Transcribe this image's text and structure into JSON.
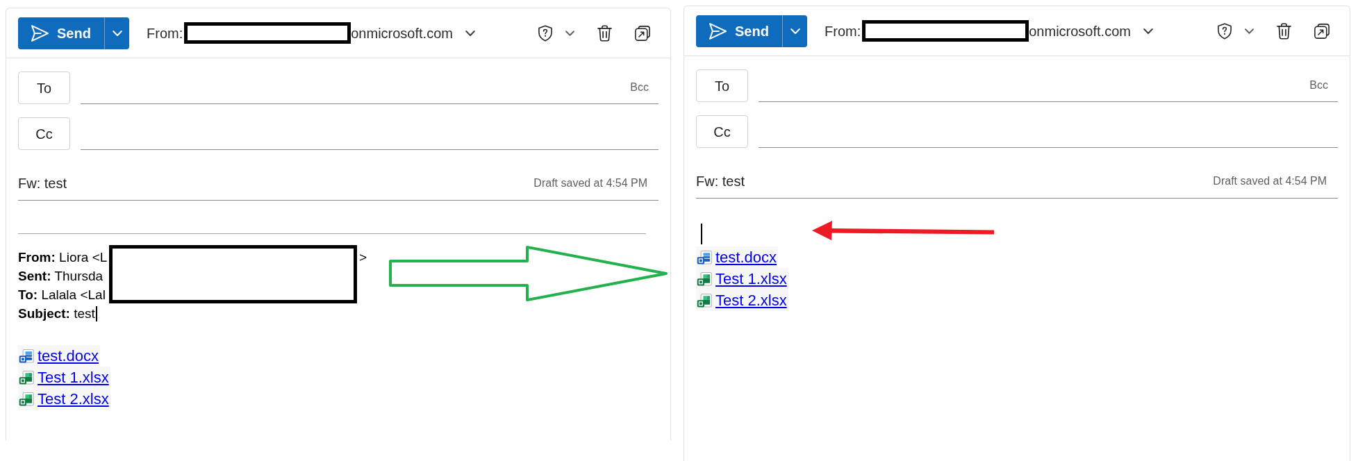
{
  "panels": [
    {
      "send_button": {
        "label": "Send"
      },
      "from": {
        "label": "From:",
        "redacted": true,
        "address": "onmicrosoft.com"
      },
      "to": {
        "label": "To",
        "bcc": "Bcc"
      },
      "cc": {
        "label": "Cc"
      },
      "subject": {
        "value": "Fw: test",
        "status": "Draft saved at 4:54 PM"
      },
      "body": [
        {
          "kind": "rule"
        },
        {
          "kind": "forwarded_header",
          "redacted": true,
          "lines": [
            {
              "text": "**From:** Liora <L",
              "tail": ">",
              "caret": false
            },
            {
              "text": "**Sent:** Thursda",
              "caret": false
            },
            {
              "text": "**To:** Lalala <Lal",
              "caret": false
            },
            {
              "text": "**Subject:** test",
              "caret": true
            }
          ]
        },
        {
          "kind": "attachments",
          "items": [
            {
              "kind": "word",
              "name": "test.docx"
            },
            {
              "kind": "excel",
              "name": "Test 1.xlsx"
            },
            {
              "kind": "excel",
              "name": "Test 2.xlsx"
            }
          ]
        }
      ]
    },
    {
      "send_button": {
        "label": "Send"
      },
      "from": {
        "label": "From:",
        "redacted": true,
        "address": "onmicrosoft.com"
      },
      "to": {
        "label": "To",
        "bcc": "Bcc"
      },
      "cc": {
        "label": "Cc"
      },
      "subject": {
        "value": "Fw: test",
        "status": "Draft saved at 4:54 PM"
      },
      "body": [
        {
          "kind": "caret_line"
        },
        {
          "kind": "attachments",
          "items": [
            {
              "kind": "word",
              "name": "test.docx"
            },
            {
              "kind": "excel",
              "name": "Test 1.xlsx"
            },
            {
              "kind": "excel",
              "name": "Test 2.xlsx"
            }
          ]
        }
      ]
    }
  ],
  "annotations": [
    {
      "kind": "outline_arrow",
      "color": "#22b14c"
    },
    {
      "kind": "filled_arrow",
      "color": "#ed1c24"
    }
  ]
}
